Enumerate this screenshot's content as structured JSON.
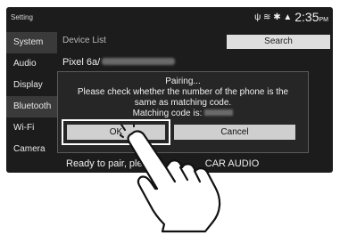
{
  "topbar": {
    "title": "Setting",
    "status_icons": "ψ ≋ ✱ ▲",
    "time": "2:35",
    "ampm": "PM"
  },
  "sidebar": {
    "items": [
      {
        "label": "System",
        "active": true
      },
      {
        "label": "Audio",
        "active": false
      },
      {
        "label": "Display",
        "active": false
      },
      {
        "label": "Bluetooth",
        "active": true
      },
      {
        "label": "Wi-Fi",
        "active": false
      },
      {
        "label": "Camera",
        "active": false
      }
    ]
  },
  "main": {
    "list_header": "Device List",
    "search_label": "Search",
    "device_name": "Pixel 6a/",
    "bottom_message": "Ready to pair, ple",
    "bottom_message_end": "CAR AUDIO"
  },
  "dialog": {
    "title": "Pairing...",
    "message_line1": "Please check whether the number of the phone is the",
    "message_line2": "same as matching code.",
    "code_label": "Matching code is:",
    "ok_label": "OK",
    "cancel_label": "Cancel"
  }
}
